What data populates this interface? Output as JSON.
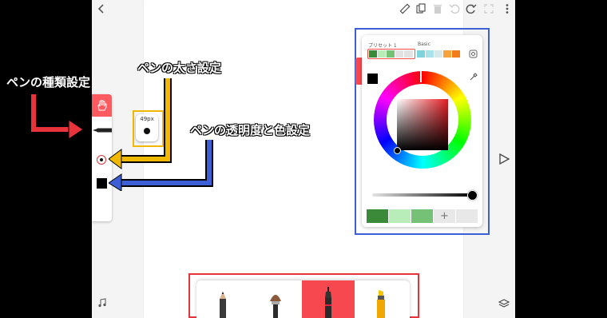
{
  "annotations": {
    "pen_type": "ペンの種類設定",
    "pen_size": "ペンの太さ設定",
    "pen_opacity_color": "ペンの透明度と色設定"
  },
  "size_popup": {
    "label": "49px"
  },
  "color_panel": {
    "preset_label": "プリセット 1",
    "basic_label": "Basic",
    "preset_swatches": [
      "#3a8a3a",
      "#b8ecb8",
      "#75c175",
      "#e2e2e2",
      "#e2e2e2"
    ],
    "basic_swatches": [
      "#7fd3dd",
      "#a9e3ea",
      "#d8e8e8",
      "#f5a33a",
      "#f07c1a"
    ],
    "selected_color": "#000000",
    "recent_swatches": [
      "#3a8a3a",
      "#b8ecb8",
      "#75c175"
    ],
    "add_glyph": "+",
    "opacity_percent": 100
  },
  "colors": {
    "accent_red": "#ff5a5f",
    "annotation_red": "#e8333a",
    "annotation_yellow": "#f0b800",
    "annotation_blue": "#3c5fd6"
  },
  "icons": [
    "back-icon",
    "ruler-icon",
    "layers-icon",
    "trash-icon",
    "undo-icon",
    "redo-icon",
    "fullscreen-icon",
    "more-icon",
    "hand-icon",
    "pen-icon",
    "eyedropper-icon",
    "settings-icon",
    "play-icon",
    "music-icon",
    "layer-stack-icon",
    "pencil-icon",
    "brush-icon",
    "marker-icon",
    "highlighter-icon"
  ]
}
